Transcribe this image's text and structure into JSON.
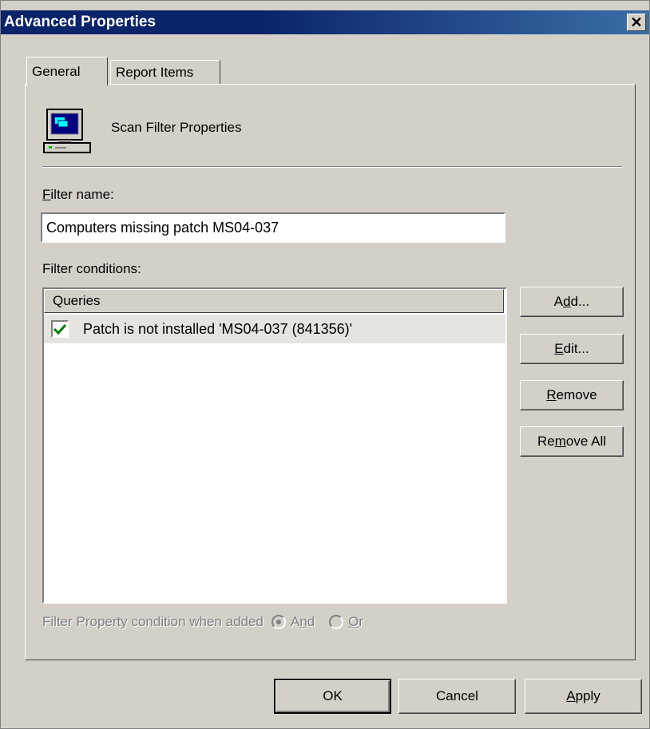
{
  "window": {
    "title": "Advanced Properties"
  },
  "tabs": [
    {
      "label": "General",
      "selected": true
    },
    {
      "label": "Report Items",
      "selected": false
    }
  ],
  "header": {
    "text": "Scan Filter Properties",
    "icon": "computer-icon"
  },
  "filter_name": {
    "label_prefix": "F",
    "label_rest": "ilter name:",
    "value": "Computers missing patch MS04-037"
  },
  "filter_conditions": {
    "label": "Filter conditions:",
    "column_header": "Queries",
    "rows": [
      {
        "checked": true,
        "text": "Patch is not installed 'MS04-037 (841356)'"
      }
    ]
  },
  "side_buttons": {
    "add": {
      "pre": "A",
      "key": "d",
      "post": "d..."
    },
    "edit": {
      "pre": "",
      "key": "E",
      "post": "dit..."
    },
    "remove": {
      "pre": "",
      "key": "R",
      "post": "emove"
    },
    "remove_all": {
      "pre": "Re",
      "key": "m",
      "post": "ove All"
    }
  },
  "condition_option": {
    "label": "Filter Property condition when added",
    "and": {
      "pre": "A",
      "key": "n",
      "post": "d",
      "selected": true
    },
    "or": {
      "pre": "",
      "key": "O",
      "post": "r",
      "selected": false
    }
  },
  "bottom_buttons": {
    "ok": "OK",
    "cancel": "Cancel",
    "apply": {
      "pre": "",
      "key": "A",
      "post": "pply"
    }
  },
  "colors": {
    "titlebar": "#0a246a",
    "face": "#d4d0c8",
    "check": "#008000"
  }
}
